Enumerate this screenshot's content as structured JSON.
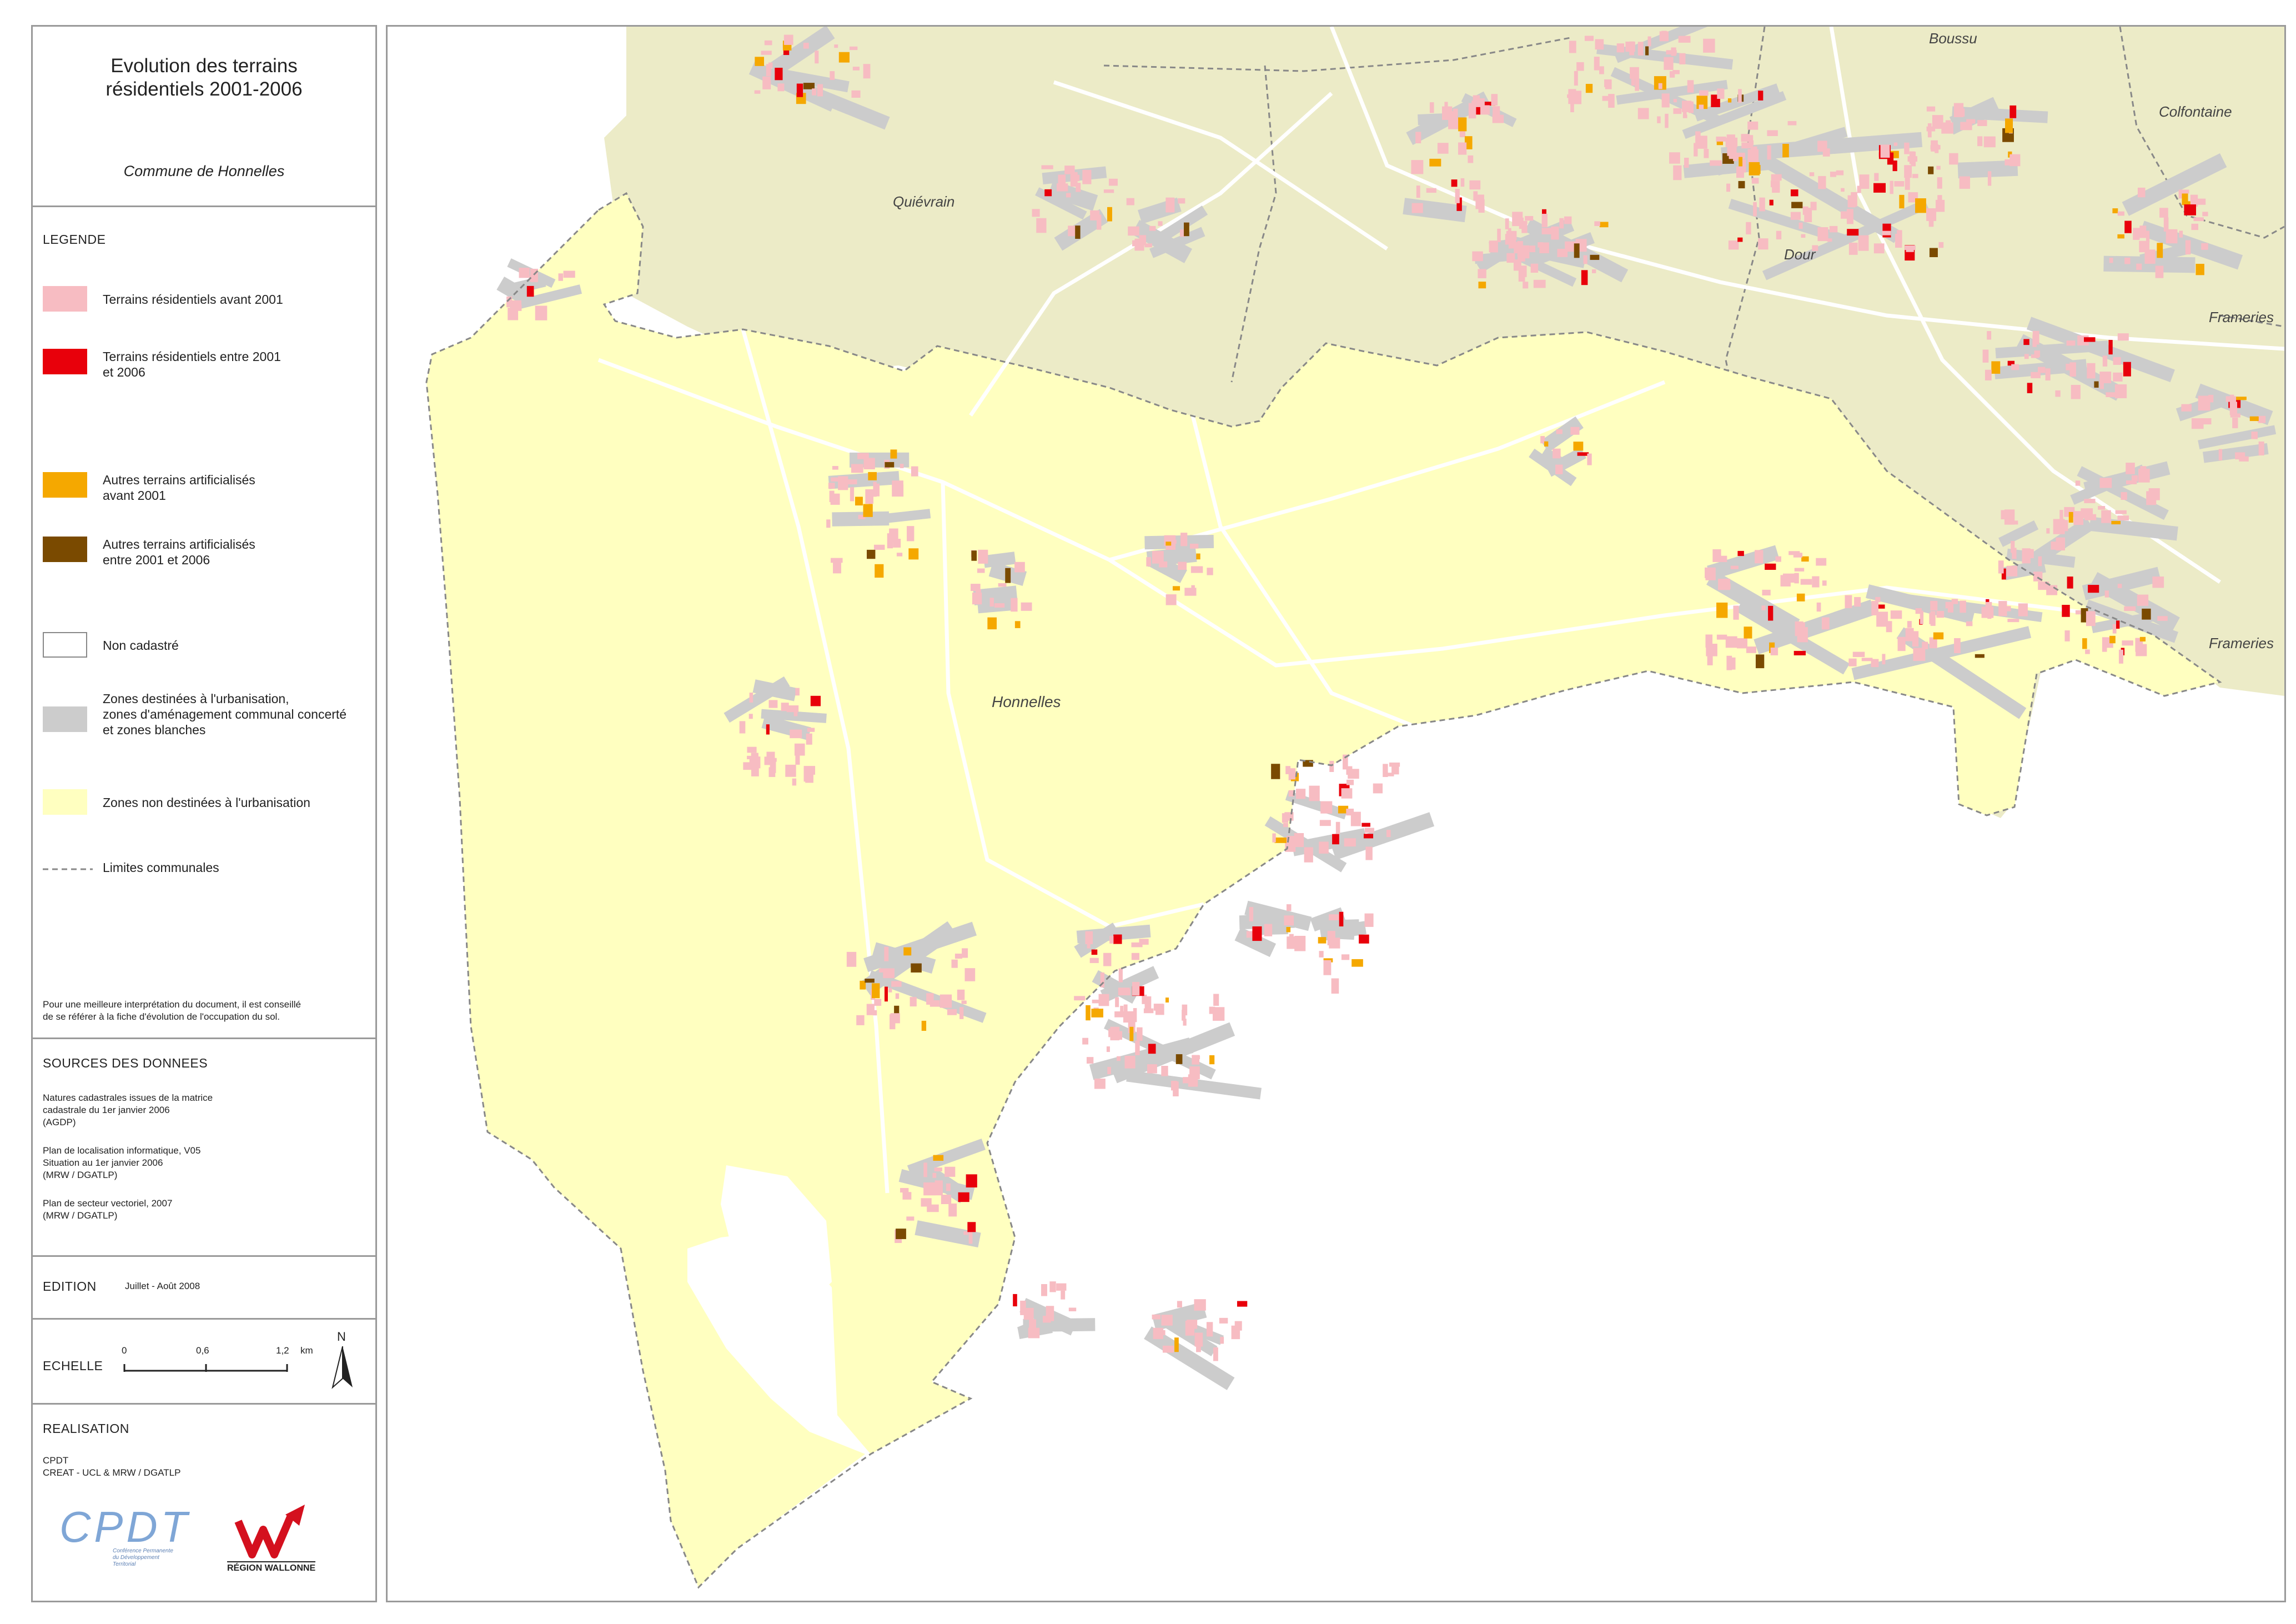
{
  "title": {
    "line1": "Evolution des terrains",
    "line2": "résidentiels 2001-2006",
    "commune": "Commune de Honnelles"
  },
  "legend": {
    "heading": "LEGENDE",
    "items": [
      {
        "label": "Terrains résidentiels avant 2001",
        "color": "#f7bcc2"
      },
      {
        "label": "Terrains résidentiels entre 2001\net 2006",
        "color": "#e8000b"
      },
      {
        "label": "Autres terrains artificialisés\navant 2001",
        "color": "#f5a800"
      },
      {
        "label": "Autres terrains artificialisés\nentre 2001 et 2006",
        "color": "#7a4a00"
      },
      {
        "label": "Non cadastré",
        "color": "#ffffff"
      },
      {
        "label": "Zones destinées à l'urbanisation,\nzones d'aménagement communal concerté\net zones blanches",
        "color": "#cccccc"
      },
      {
        "label": "Zones non destinées à l'urbanisation",
        "color": "#ffffc0"
      },
      {
        "label": "Limites communales",
        "color": "#888888"
      }
    ],
    "note": "Pour une meilleure interprétation du document, il est conseillé\nde se référer à la fiche d'évolution de l'occupation du sol."
  },
  "sources": {
    "heading": "SOURCES DES DONNEES",
    "entries": [
      "Natures cadastrales issues de la matrice\ncadastrale du 1er janvier 2006\n(AGDP)",
      "Plan de localisation informatique, V05\nSituation au 1er janvier 2006\n(MRW / DGATLP)",
      "Plan de secteur vectoriel, 2007\n(MRW / DGATLP)"
    ]
  },
  "edition": {
    "heading": "EDITION",
    "value": "Juillet - Août 2008"
  },
  "scale": {
    "heading": "ECHELLE",
    "ticks": [
      "0",
      "0,6",
      "1,2"
    ],
    "unit": "km",
    "north": "N"
  },
  "realisation": {
    "heading": "REALISATION",
    "line1": "CPDT",
    "line2": "CREAT - UCL & MRW / DGATLP",
    "logo_cpdt": "CPDT",
    "logo_cpdt_sub": "Conférence Permanente\ndu Développement\nTerritorial",
    "logo_rw": "RÉGION WALLONNE"
  },
  "map": {
    "labels": [
      "Boussu",
      "Colfontaine",
      "Quiévrain",
      "Dour",
      "Frameries",
      "Frameries",
      "Honnelles"
    ],
    "colors": {
      "neighbor": "#ecebc7",
      "commune": "#ffffc0",
      "road": "#ffffff",
      "residential_old": "#f7bcc2",
      "residential_new": "#e8000b",
      "artificial_old": "#f5a800",
      "artificial_new": "#7a4a00",
      "urban_zone": "#cccccc",
      "boundary": "#888888"
    }
  }
}
